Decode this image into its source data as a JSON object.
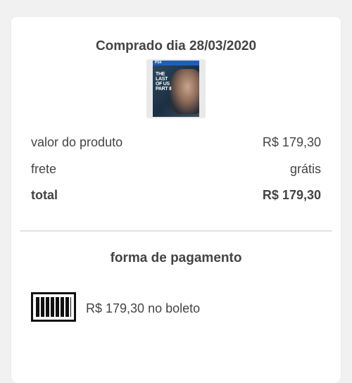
{
  "order": {
    "purchased_label": "Comprado dia 28/03/2020",
    "product_image": {
      "platform": "PS4",
      "title_lines": [
        "THE",
        "LAST",
        "OF US",
        "PART II"
      ]
    }
  },
  "summary": {
    "rows": [
      {
        "label": "valor do produto",
        "value": "R$ 179,30"
      },
      {
        "label": "frete",
        "value": "grátis"
      },
      {
        "label": "total",
        "value": "R$ 179,30"
      }
    ]
  },
  "payment": {
    "title": "forma de pagamento",
    "method_icon": "barcode-icon",
    "description": "R$ 179,30 no boleto"
  }
}
